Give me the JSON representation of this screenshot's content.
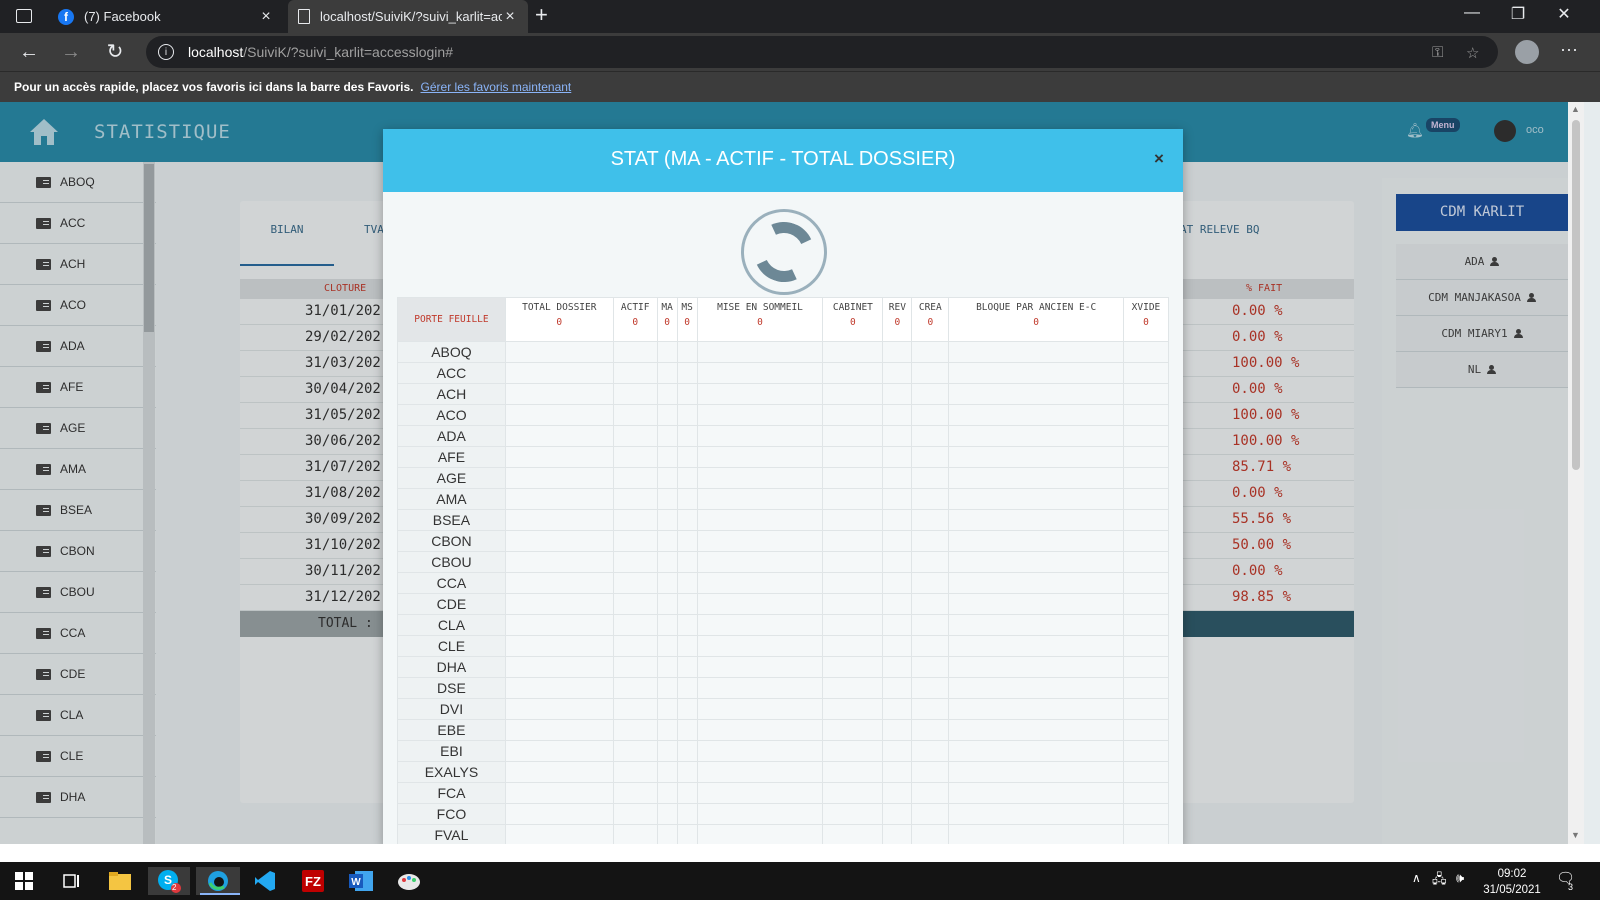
{
  "browser": {
    "tabs": [
      {
        "title": "(7) Facebook"
      },
      {
        "title": "localhost/SuiviK/?suivi_karlit=acc"
      }
    ],
    "url_host": "localhost",
    "url_path": "/SuiviK/?suivi_karlit=accesslogin#",
    "favorites_text": "Pour un accès rapide, placez vos favoris ici dans la barre des Favoris.",
    "favorites_link": "Gérer les favoris maintenant"
  },
  "header": {
    "title": "STATISTIQUE",
    "menu_badge": "Menu",
    "user_name": "oco"
  },
  "sidebar": {
    "items": [
      "ABOQ",
      "ACC",
      "ACH",
      "ACO",
      "ADA",
      "AFE",
      "AGE",
      "AMA",
      "BSEA",
      "CBON",
      "CBOU",
      "CCA",
      "CDE",
      "CLA",
      "CLE",
      "DHA"
    ]
  },
  "background_panel": {
    "tabs": [
      "BILAN",
      "TVA",
      "AT RELEVE BQ"
    ],
    "col_cloture": "CLOTURE",
    "col_fait": "% FAIT",
    "rows": [
      {
        "date": "31/01/202",
        "pct": "0.00 %"
      },
      {
        "date": "29/02/202",
        "pct": "0.00 %"
      },
      {
        "date": "31/03/202",
        "pct": "100.00 %"
      },
      {
        "date": "30/04/202",
        "pct": "0.00 %"
      },
      {
        "date": "31/05/202",
        "pct": "100.00 %"
      },
      {
        "date": "30/06/202",
        "pct": "100.00 %"
      },
      {
        "date": "31/07/202",
        "pct": "85.71 %"
      },
      {
        "date": "31/08/202",
        "pct": "0.00 %"
      },
      {
        "date": "30/09/202",
        "pct": "55.56 %"
      },
      {
        "date": "31/10/202",
        "pct": "50.00 %"
      },
      {
        "date": "30/11/202",
        "pct": "0.00 %"
      },
      {
        "date": "31/12/202",
        "pct": "98.85 %"
      }
    ],
    "total_label": "TOTAL :"
  },
  "right_column": {
    "heading": "CDM KARLIT",
    "items": [
      "ADA",
      "CDM MANJAKASOA",
      "CDM MIARY1",
      "NL"
    ]
  },
  "modal": {
    "title": "STAT (MA - ACTIF - TOTAL DOSSIER)",
    "close": "×",
    "first_header": "PORTE FEUILLE",
    "columns": [
      {
        "label": "TOTAL DOSSIER",
        "value": "0"
      },
      {
        "label": "ACTIF",
        "value": "0"
      },
      {
        "label": "MA",
        "value": "0"
      },
      {
        "label": "MS",
        "value": "0"
      },
      {
        "label": "MISE EN SOMMEIL",
        "value": "0"
      },
      {
        "label": "CABINET",
        "value": "0"
      },
      {
        "label": "REV",
        "value": "0"
      },
      {
        "label": "CREA",
        "value": "0"
      },
      {
        "label": "BLOQUE PAR ANCIEN E-C",
        "value": "0"
      },
      {
        "label": "XVIDE",
        "value": "0"
      }
    ],
    "rows": [
      "ABOQ",
      "ACC",
      "ACH",
      "ACO",
      "ADA",
      "AFE",
      "AGE",
      "AMA",
      "BSEA",
      "CBON",
      "CBOU",
      "CCA",
      "CDE",
      "CLA",
      "CLE",
      "DHA",
      "DSE",
      "DVI",
      "EBE",
      "EBI",
      "EXALYS",
      "FCA",
      "FCO",
      "FVAL"
    ]
  },
  "taskbar": {
    "time": "09:02",
    "date": "31/05/2021",
    "notification_count": "3",
    "skype_badge": "2"
  }
}
